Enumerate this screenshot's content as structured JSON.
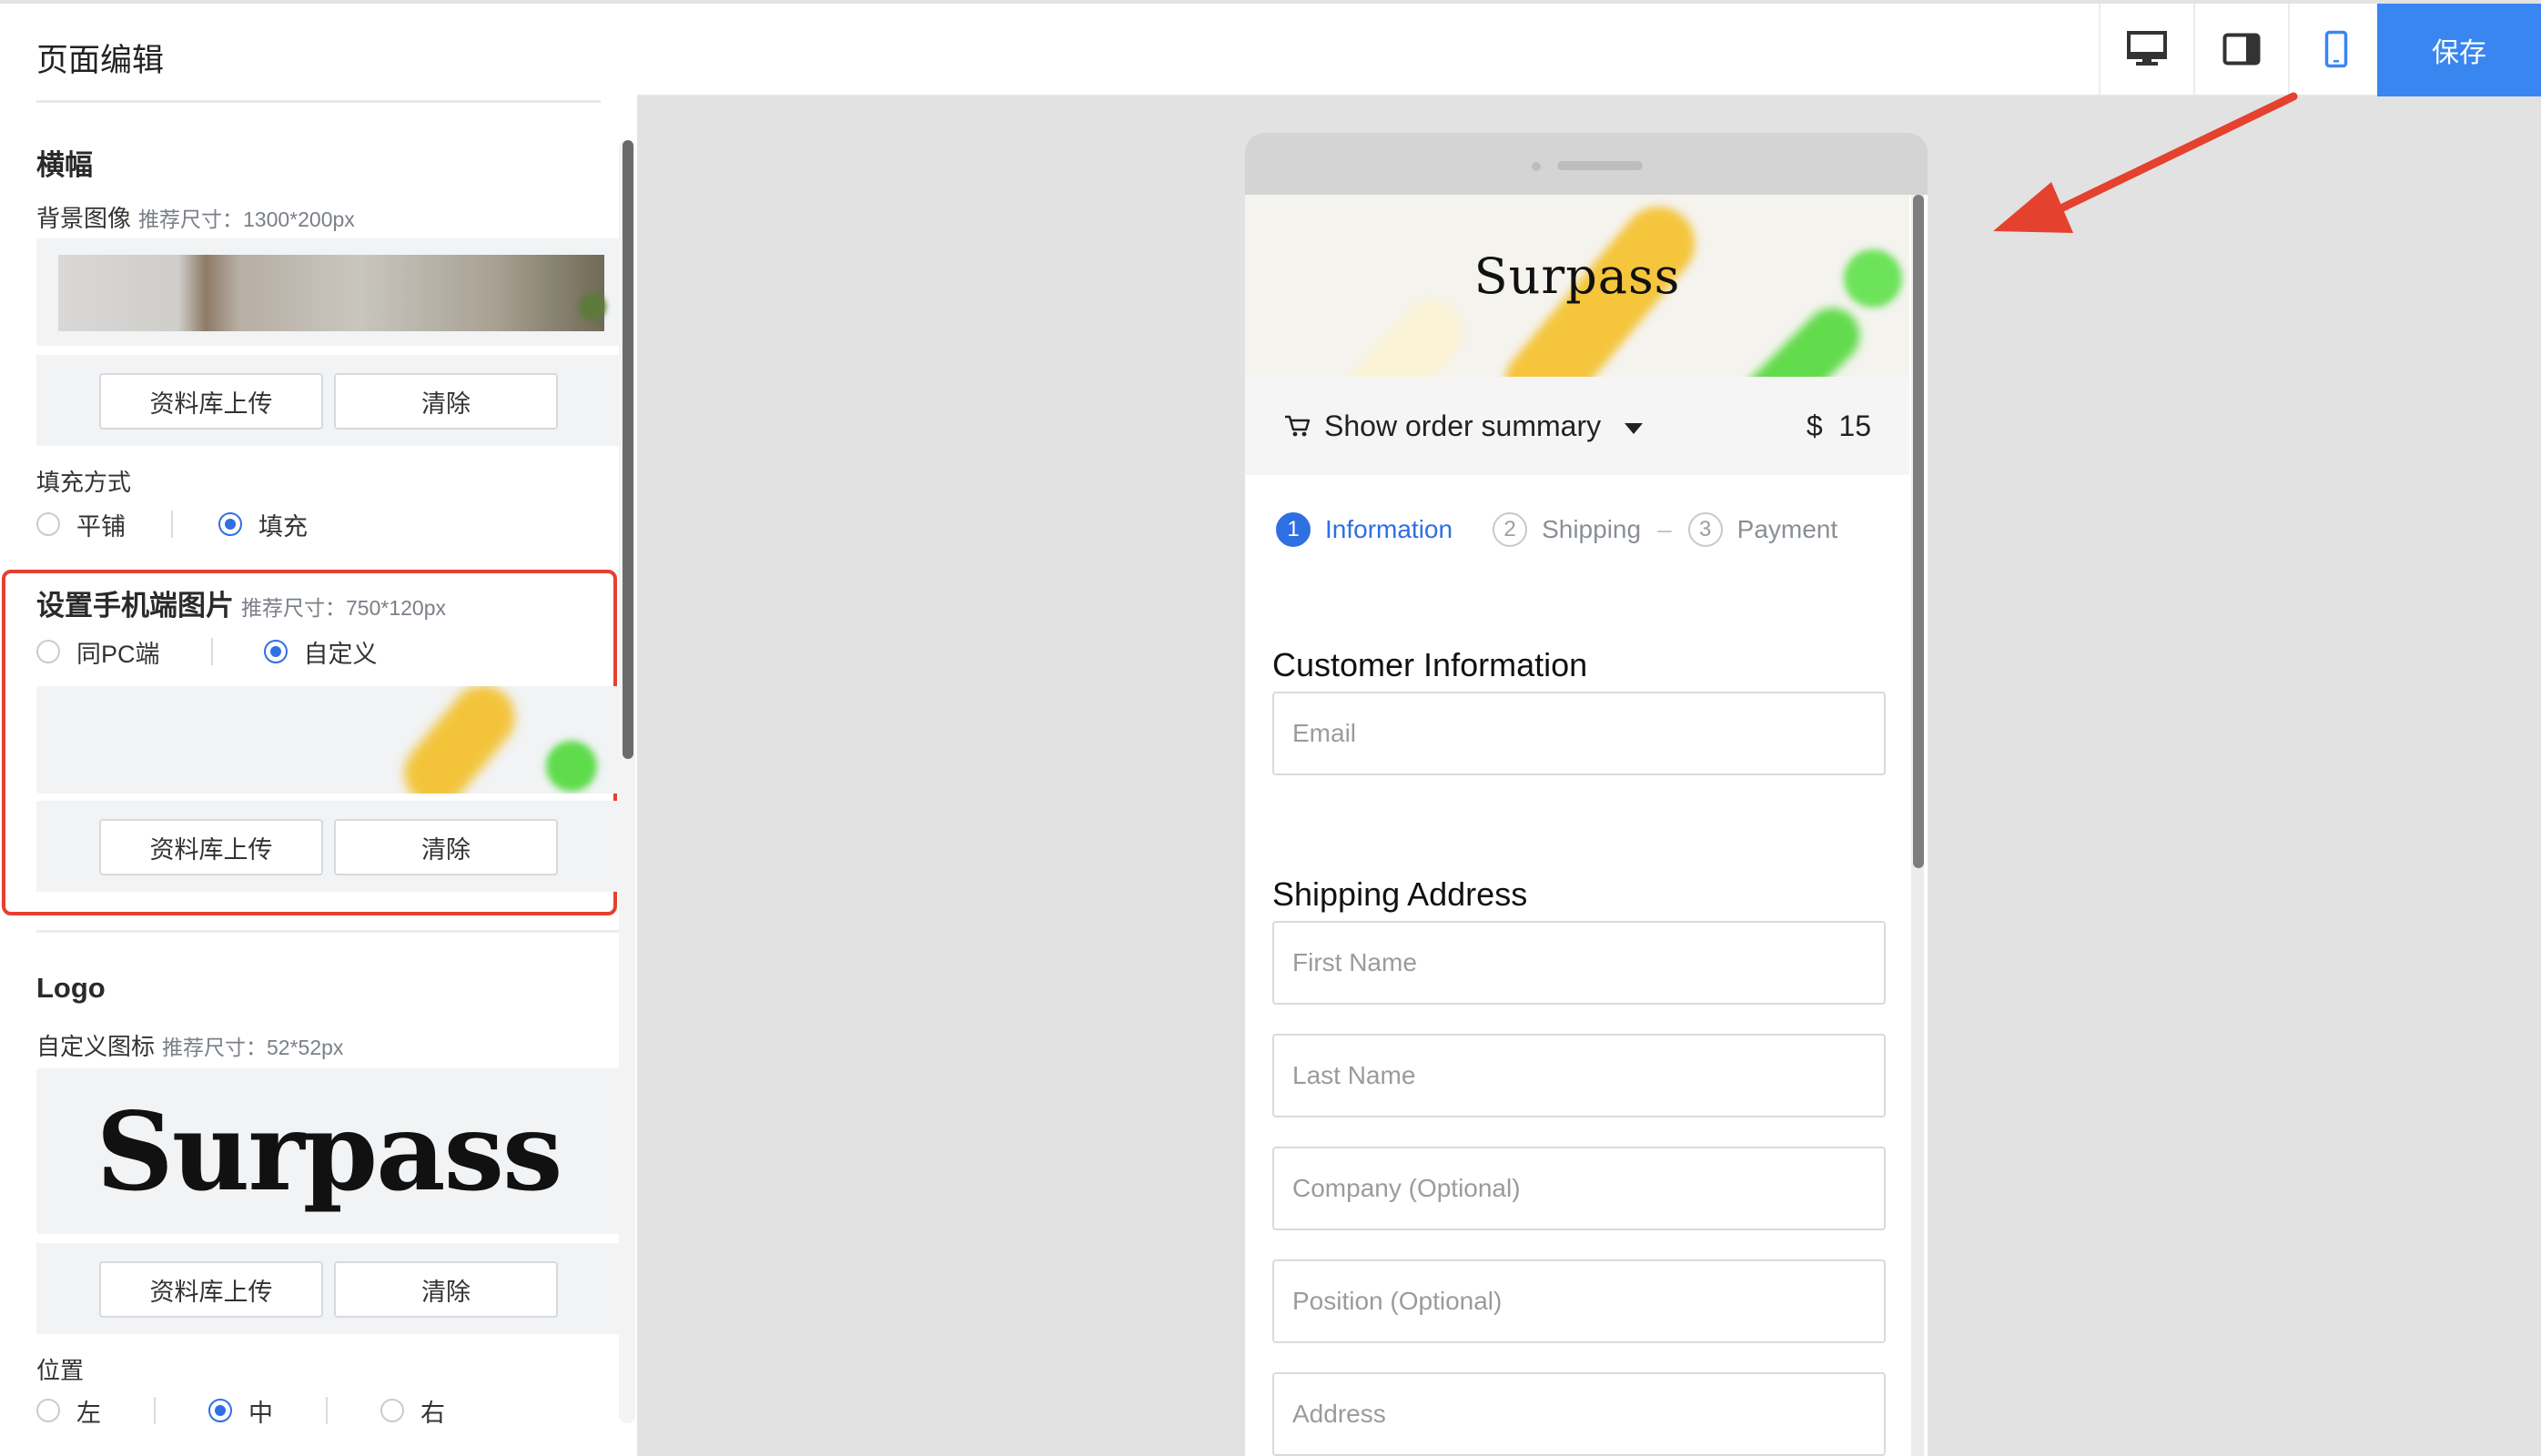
{
  "editor": {
    "title": "页面编辑",
    "banner": {
      "title": "横幅",
      "bg_label": "背景图像",
      "bg_hint": "推荐尺寸：1300*200px",
      "upload_label": "资料库上传",
      "clear_label": "清除",
      "fill_label": "填充方式",
      "fill_options": [
        "平铺",
        "填充"
      ],
      "fill_selected": "填充"
    },
    "mobile": {
      "title": "设置手机端图片",
      "hint": "推荐尺寸：750*120px",
      "options": [
        "同PC端",
        "自定义"
      ],
      "selected": "自定义",
      "upload_label": "资料库上传",
      "clear_label": "清除"
    },
    "logo": {
      "title": "Logo",
      "icon_label": "自定义图标",
      "icon_hint": "推荐尺寸：52*52px",
      "preview_text": "Surpass",
      "upload_label": "资料库上传",
      "clear_label": "清除",
      "position_label": "位置",
      "position_options": [
        "左",
        "中",
        "右"
      ],
      "position_selected": "中"
    }
  },
  "toolbar": {
    "devices": [
      "desktop-icon",
      "tablet-icon",
      "mobile-icon"
    ],
    "active_device": "mobile-icon",
    "save_label": "保存",
    "accent_color": "#3a86f0"
  },
  "preview": {
    "logo_text": "Surpass",
    "summary_label": "Show order summary",
    "currency": "$",
    "total": "15",
    "steps": [
      {
        "num": "1",
        "label": "Information"
      },
      {
        "num": "2",
        "label": "Shipping"
      },
      {
        "num": "3",
        "label": "Payment"
      }
    ],
    "step_separator": "–",
    "customer_heading": "Customer Information",
    "email_placeholder": "Email",
    "shipping_heading": "Shipping Address",
    "fields": [
      "First Name",
      "Last Name",
      "Company (Optional)",
      "Position (Optional)",
      "Address"
    ]
  },
  "annotation": {
    "highlight_color": "#e5412f"
  }
}
